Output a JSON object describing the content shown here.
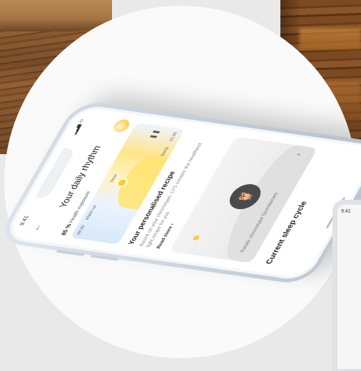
{
  "phone": {
    "status_time": "9:41",
    "title": "Your daily rhythm",
    "exposure_value": "85 %",
    "exposure_label": "Health exposure",
    "rhythm_labels": {
      "start_time": "08.30",
      "start_label": "Wake up",
      "mid_label": "Now",
      "end_label": "Sleep",
      "end_time": "21.30"
    },
    "recipe_title": "Your personalised recipe",
    "recipe_text": "Based on your chronotype, LYS creates the healthiest light recipe for you",
    "read_more": "Read more",
    "quiz_label": "Rotate chronotype Questionary",
    "sleep_title": "Current sleep cycle"
  },
  "second_phone": {
    "status_time": "9:41"
  },
  "icons": {
    "back": "arrow-left-icon",
    "sun": "sun-icon",
    "owl": "owl-icon",
    "chevron": "chevron-right-icon",
    "pause": "pause-icon"
  }
}
